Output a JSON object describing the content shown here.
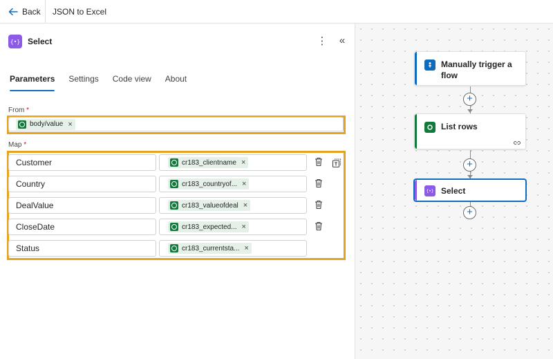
{
  "topbar": {
    "back_label": "Back",
    "flow_title": "JSON to Excel"
  },
  "panel": {
    "title": "Select",
    "icon_text": "{•}",
    "more_label": "⋮",
    "collapse_label": "«",
    "tabs": [
      {
        "label": "Parameters",
        "active": true
      },
      {
        "label": "Settings"
      },
      {
        "label": "Code view"
      },
      {
        "label": "About"
      }
    ],
    "from_label": "From",
    "map_label": "Map",
    "required_mark": "*",
    "from_token": "body/value",
    "map_rows": [
      {
        "key": "Customer",
        "value": "cr183_clientname"
      },
      {
        "key": "Country",
        "value": "cr183_countryof..."
      },
      {
        "key": "DealValue",
        "value": "cr183_valueofdeal"
      },
      {
        "key": "CloseDate",
        "value": "cr183_expected..."
      },
      {
        "key": "Status",
        "value": "cr183_currentsta..."
      }
    ],
    "chip_remove": "×"
  },
  "canvas": {
    "nodes": [
      {
        "title": "Manually trigger a flow",
        "accent": "#0f6cbd"
      },
      {
        "title": "List rows",
        "accent": "#117a3b"
      },
      {
        "title": "Select",
        "accent": "#8c5ae6"
      }
    ],
    "plus_label": "+"
  },
  "colors": {
    "highlight": "#e8a31e",
    "primary": "#0f6cbd",
    "dataverse": "#117a3b",
    "select": "#8c5ae6"
  }
}
